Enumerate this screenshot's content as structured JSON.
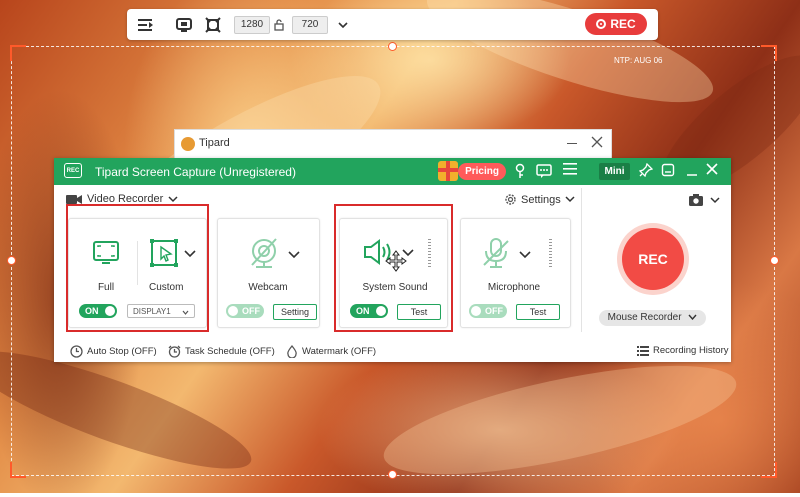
{
  "toolbar": {
    "width": "1280",
    "height": "720",
    "rec_label": "REC"
  },
  "overlay": {
    "ntp_text": "NTP: AUG 06"
  },
  "background_window": {
    "title": "Tipard"
  },
  "app": {
    "title": "Tipard Screen Capture (Unregistered)",
    "pricing_label": "Pricing",
    "mini_label": "Mini",
    "mode_label": "Video Recorder",
    "settings_label": "Settings",
    "display": {
      "full_label": "Full",
      "custom_label": "Custom",
      "toggle_label": "ON",
      "display_select": "DISPLAY1"
    },
    "webcam": {
      "label": "Webcam",
      "toggle_label": "OFF",
      "button_label": "Setting"
    },
    "system_sound": {
      "label": "System Sound",
      "toggle_label": "ON",
      "button_label": "Test"
    },
    "microphone": {
      "label": "Microphone",
      "toggle_label": "OFF",
      "button_label": "Test"
    },
    "rec_label": "REC",
    "mouse_recorder_label": "Mouse Recorder",
    "footer": {
      "auto_stop": "Auto Stop (OFF)",
      "task_schedule": "Task Schedule (OFF)",
      "watermark": "Watermark (OFF)",
      "recording_history": "Recording History"
    }
  },
  "colors": {
    "accent_green": "#22a45d",
    "rec_red": "#f24b45",
    "highlight_red": "#d92b2b",
    "selection_orange": "#ff5a2a"
  }
}
